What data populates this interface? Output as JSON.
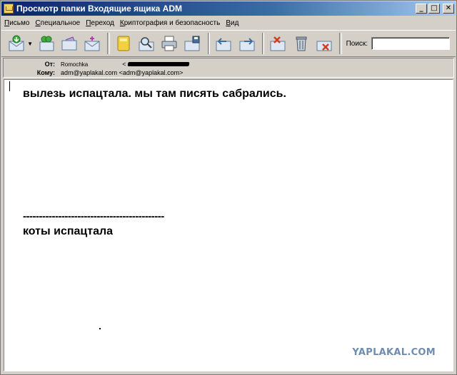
{
  "window": {
    "title": "Просмотр папки Входящие ящика ADM"
  },
  "menu": [
    {
      "u": "П",
      "rest": "исьмо"
    },
    {
      "u": "С",
      "rest": "пециальное"
    },
    {
      "u": "П",
      "rest": "ереход"
    },
    {
      "u": "К",
      "rest": "риптография и безопасность"
    },
    {
      "u": "В",
      "rest": "ид"
    }
  ],
  "search": {
    "label": "Поиск:",
    "value": ""
  },
  "headers": {
    "from_label": "От:",
    "from_name": "Romochka",
    "from_addr_open": "<",
    "to_label": "Кому:",
    "to_value": "adm@yaplakal.com <adm@yaplakal.com>"
  },
  "message": {
    "line1": "вылезь испацтала. мы там писять сабрались.",
    "separator": "--------------------------------------------",
    "line2": "коты испацтала"
  },
  "watermark": "YAPLAKAL.COM",
  "colors": {
    "titlebar": "#0a246a",
    "chrome": "#d4d0c8",
    "watermark": "#6f8caf"
  }
}
